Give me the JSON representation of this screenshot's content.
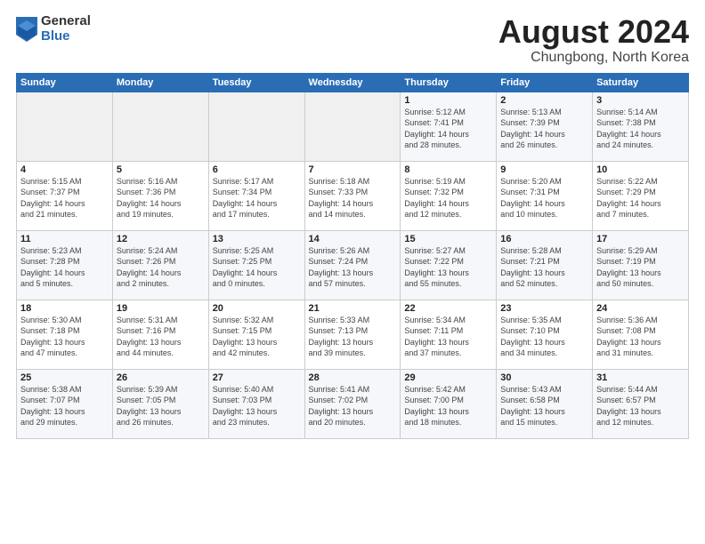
{
  "logo": {
    "general": "General",
    "blue": "Blue"
  },
  "title": {
    "month_year": "August 2024",
    "location": "Chungbong, North Korea"
  },
  "days_of_week": [
    "Sunday",
    "Monday",
    "Tuesday",
    "Wednesday",
    "Thursday",
    "Friday",
    "Saturday"
  ],
  "weeks": [
    [
      {
        "day": "",
        "info": ""
      },
      {
        "day": "",
        "info": ""
      },
      {
        "day": "",
        "info": ""
      },
      {
        "day": "",
        "info": ""
      },
      {
        "day": "1",
        "info": "Sunrise: 5:12 AM\nSunset: 7:41 PM\nDaylight: 14 hours\nand 28 minutes."
      },
      {
        "day": "2",
        "info": "Sunrise: 5:13 AM\nSunset: 7:39 PM\nDaylight: 14 hours\nand 26 minutes."
      },
      {
        "day": "3",
        "info": "Sunrise: 5:14 AM\nSunset: 7:38 PM\nDaylight: 14 hours\nand 24 minutes."
      }
    ],
    [
      {
        "day": "4",
        "info": "Sunrise: 5:15 AM\nSunset: 7:37 PM\nDaylight: 14 hours\nand 21 minutes."
      },
      {
        "day": "5",
        "info": "Sunrise: 5:16 AM\nSunset: 7:36 PM\nDaylight: 14 hours\nand 19 minutes."
      },
      {
        "day": "6",
        "info": "Sunrise: 5:17 AM\nSunset: 7:34 PM\nDaylight: 14 hours\nand 17 minutes."
      },
      {
        "day": "7",
        "info": "Sunrise: 5:18 AM\nSunset: 7:33 PM\nDaylight: 14 hours\nand 14 minutes."
      },
      {
        "day": "8",
        "info": "Sunrise: 5:19 AM\nSunset: 7:32 PM\nDaylight: 14 hours\nand 12 minutes."
      },
      {
        "day": "9",
        "info": "Sunrise: 5:20 AM\nSunset: 7:31 PM\nDaylight: 14 hours\nand 10 minutes."
      },
      {
        "day": "10",
        "info": "Sunrise: 5:22 AM\nSunset: 7:29 PM\nDaylight: 14 hours\nand 7 minutes."
      }
    ],
    [
      {
        "day": "11",
        "info": "Sunrise: 5:23 AM\nSunset: 7:28 PM\nDaylight: 14 hours\nand 5 minutes."
      },
      {
        "day": "12",
        "info": "Sunrise: 5:24 AM\nSunset: 7:26 PM\nDaylight: 14 hours\nand 2 minutes."
      },
      {
        "day": "13",
        "info": "Sunrise: 5:25 AM\nSunset: 7:25 PM\nDaylight: 14 hours\nand 0 minutes."
      },
      {
        "day": "14",
        "info": "Sunrise: 5:26 AM\nSunset: 7:24 PM\nDaylight: 13 hours\nand 57 minutes."
      },
      {
        "day": "15",
        "info": "Sunrise: 5:27 AM\nSunset: 7:22 PM\nDaylight: 13 hours\nand 55 minutes."
      },
      {
        "day": "16",
        "info": "Sunrise: 5:28 AM\nSunset: 7:21 PM\nDaylight: 13 hours\nand 52 minutes."
      },
      {
        "day": "17",
        "info": "Sunrise: 5:29 AM\nSunset: 7:19 PM\nDaylight: 13 hours\nand 50 minutes."
      }
    ],
    [
      {
        "day": "18",
        "info": "Sunrise: 5:30 AM\nSunset: 7:18 PM\nDaylight: 13 hours\nand 47 minutes."
      },
      {
        "day": "19",
        "info": "Sunrise: 5:31 AM\nSunset: 7:16 PM\nDaylight: 13 hours\nand 44 minutes."
      },
      {
        "day": "20",
        "info": "Sunrise: 5:32 AM\nSunset: 7:15 PM\nDaylight: 13 hours\nand 42 minutes."
      },
      {
        "day": "21",
        "info": "Sunrise: 5:33 AM\nSunset: 7:13 PM\nDaylight: 13 hours\nand 39 minutes."
      },
      {
        "day": "22",
        "info": "Sunrise: 5:34 AM\nSunset: 7:11 PM\nDaylight: 13 hours\nand 37 minutes."
      },
      {
        "day": "23",
        "info": "Sunrise: 5:35 AM\nSunset: 7:10 PM\nDaylight: 13 hours\nand 34 minutes."
      },
      {
        "day": "24",
        "info": "Sunrise: 5:36 AM\nSunset: 7:08 PM\nDaylight: 13 hours\nand 31 minutes."
      }
    ],
    [
      {
        "day": "25",
        "info": "Sunrise: 5:38 AM\nSunset: 7:07 PM\nDaylight: 13 hours\nand 29 minutes."
      },
      {
        "day": "26",
        "info": "Sunrise: 5:39 AM\nSunset: 7:05 PM\nDaylight: 13 hours\nand 26 minutes."
      },
      {
        "day": "27",
        "info": "Sunrise: 5:40 AM\nSunset: 7:03 PM\nDaylight: 13 hours\nand 23 minutes."
      },
      {
        "day": "28",
        "info": "Sunrise: 5:41 AM\nSunset: 7:02 PM\nDaylight: 13 hours\nand 20 minutes."
      },
      {
        "day": "29",
        "info": "Sunrise: 5:42 AM\nSunset: 7:00 PM\nDaylight: 13 hours\nand 18 minutes."
      },
      {
        "day": "30",
        "info": "Sunrise: 5:43 AM\nSunset: 6:58 PM\nDaylight: 13 hours\nand 15 minutes."
      },
      {
        "day": "31",
        "info": "Sunrise: 5:44 AM\nSunset: 6:57 PM\nDaylight: 13 hours\nand 12 minutes."
      }
    ]
  ]
}
